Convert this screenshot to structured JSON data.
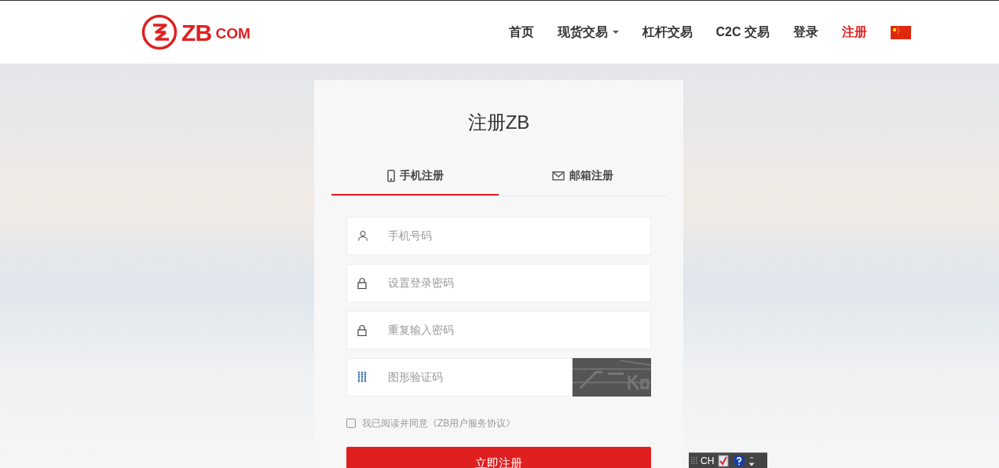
{
  "header": {
    "logo": {
      "main": "ZB",
      "suffix": "COM"
    },
    "nav": [
      {
        "label": "首页",
        "selected": false,
        "dropdown": false
      },
      {
        "label": "现货交易",
        "selected": false,
        "dropdown": true
      },
      {
        "label": "杠杆交易",
        "selected": false,
        "dropdown": false
      },
      {
        "label": "C2C 交易",
        "selected": false,
        "dropdown": false
      },
      {
        "label": "登录",
        "selected": false,
        "dropdown": false
      },
      {
        "label": "注册",
        "selected": true,
        "dropdown": false
      }
    ]
  },
  "form": {
    "title": "注册ZB",
    "tabs": [
      {
        "label": "手机注册",
        "kind": "phone",
        "selected": true
      },
      {
        "label": "邮箱注册",
        "kind": "email",
        "selected": false
      }
    ],
    "fields": [
      {
        "kind": "user",
        "placeholder": "手机号码"
      },
      {
        "kind": "lock",
        "placeholder": "设置登录密码"
      },
      {
        "kind": "lock",
        "placeholder": "重复输入密码"
      },
      {
        "kind": "captcha",
        "placeholder": "图形验证码"
      }
    ],
    "agreement": {
      "checked": false,
      "label": "我已阅读并同意《ZB用户服务协议》"
    },
    "submit": "立即注册"
  },
  "language_bar": {
    "label": "CH"
  }
}
